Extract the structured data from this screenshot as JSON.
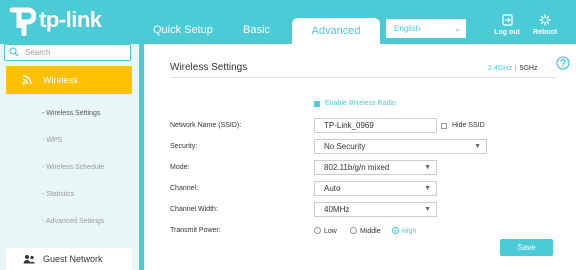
{
  "brand": {
    "logo_text": "tp-link",
    "accent": "#4acbd6",
    "highlight": "#ffc000"
  },
  "header": {
    "tabs": [
      {
        "label": "Quick Setup",
        "active": false
      },
      {
        "label": "Basic",
        "active": false
      },
      {
        "label": "Advanced",
        "active": true
      }
    ],
    "language": {
      "selected": "English",
      "icon": "chevron-down-icon"
    },
    "logout": {
      "label": "Log out",
      "icon": "logout-icon"
    },
    "reboot": {
      "label": "Reboot",
      "icon": "reboot-icon"
    }
  },
  "sidebar": {
    "search": {
      "placeholder": "Search",
      "icon": "search-icon"
    },
    "active_menu": {
      "label": "Wireless",
      "icon": "wifi-icon"
    },
    "sub_items": [
      {
        "label": "- Wireless Settings",
        "active": true
      },
      {
        "label": "- WPS",
        "active": false
      },
      {
        "label": "- Wireless Schedule",
        "active": false
      },
      {
        "label": "- Statistics",
        "active": false
      },
      {
        "label": "- Advanced Settings",
        "active": false
      }
    ],
    "next_menu": {
      "label": "Guest Network",
      "icon": "guest-network-icon"
    }
  },
  "main": {
    "title": "Wireless Settings",
    "bands": {
      "b24": "2.4GHz",
      "b5": "5GHz",
      "selected": "2.4GHz"
    },
    "help_icon": "help-icon",
    "enable_radio": {
      "label": "Enable Wireless Radio",
      "checked": true
    },
    "fields": {
      "ssid": {
        "label": "Network Name (SSID):",
        "value": "TP-Link_0969"
      },
      "hide_ssid": {
        "label": "Hide SSID",
        "checked": false
      },
      "security": {
        "label": "Security:",
        "value": "No Security"
      },
      "mode": {
        "label": "Mode:",
        "value": "802.11b/g/n mixed"
      },
      "channel": {
        "label": "Channel:",
        "value": "Auto"
      },
      "channel_width": {
        "label": "Channel Width:",
        "value": "40MHz"
      },
      "transmit_power": {
        "label": "Transmit Power:",
        "options": [
          "Low",
          "Middle",
          "High"
        ],
        "selected": "High"
      }
    },
    "save_label": "Save"
  }
}
